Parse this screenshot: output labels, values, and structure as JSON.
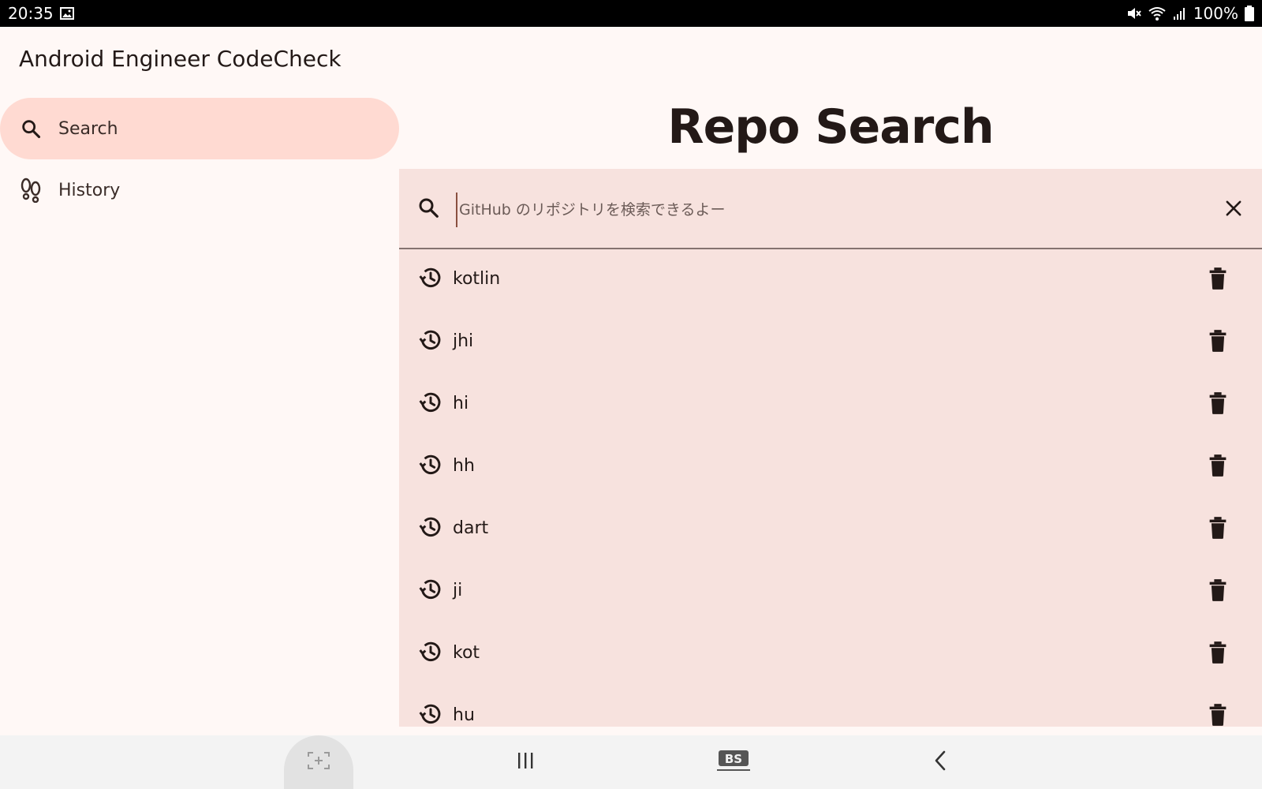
{
  "status_bar": {
    "time": "20:35",
    "battery": "100%",
    "icons": [
      "gallery-icon",
      "mute-icon",
      "wifi-icon",
      "signal-icon",
      "battery-icon"
    ]
  },
  "app": {
    "title": "Android Engineer CodeCheck"
  },
  "nav": {
    "items": [
      {
        "label": "Search",
        "icon": "search-icon",
        "active": true
      },
      {
        "label": "History",
        "icon": "footprints-icon",
        "active": false
      }
    ]
  },
  "main": {
    "title": "Repo Search",
    "search": {
      "value": "",
      "placeholder": "GitHub のリポジトリを検索できるよー",
      "leading_icon": "search-icon",
      "trailing_icon": "close-icon"
    },
    "history": [
      {
        "query": "kotlin"
      },
      {
        "query": "jhi"
      },
      {
        "query": "hi"
      },
      {
        "query": "hh"
      },
      {
        "query": "dart"
      },
      {
        "query": "ji"
      },
      {
        "query": "kot"
      },
      {
        "query": "hu"
      }
    ]
  },
  "system_nav": {
    "buttons": [
      "capture-icon",
      "recent-apps-icon",
      "blacksteel-logo-icon",
      "back-icon"
    ],
    "logo_text": "BS"
  },
  "colors": {
    "background": "#FFF8F6",
    "active_nav": "#FFDAD2",
    "panel": "#F7E2DE",
    "text": "#231917"
  }
}
